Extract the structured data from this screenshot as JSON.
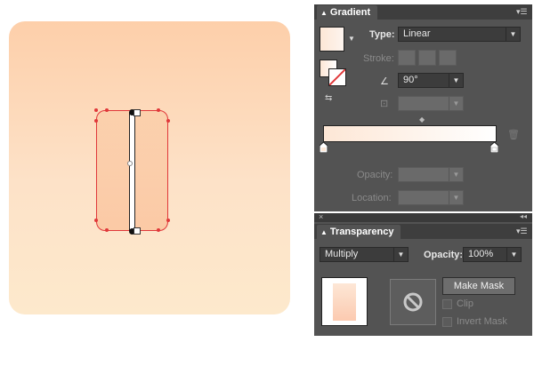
{
  "gradient_panel": {
    "title": "Gradient",
    "type_label": "Type:",
    "type_value": "Linear",
    "stroke_label": "Stroke:",
    "angle_value": "90°",
    "opacity_label": "Opacity:",
    "location_label": "Location:",
    "gradient_colors": [
      "#fde7d6",
      "#ffffff"
    ]
  },
  "transparency_panel": {
    "title": "Transparency",
    "blend_mode": "Multiply",
    "opacity_label": "Opacity:",
    "opacity_value": "100%",
    "make_mask_label": "Make Mask",
    "clip_label": "Clip",
    "invert_mask_label": "Invert Mask"
  },
  "colors": {
    "panel_bg": "#535353",
    "selection_stroke": "#e0383a",
    "artboard_top": "#fdcfaa",
    "artboard_bottom": "#fde9cc"
  }
}
